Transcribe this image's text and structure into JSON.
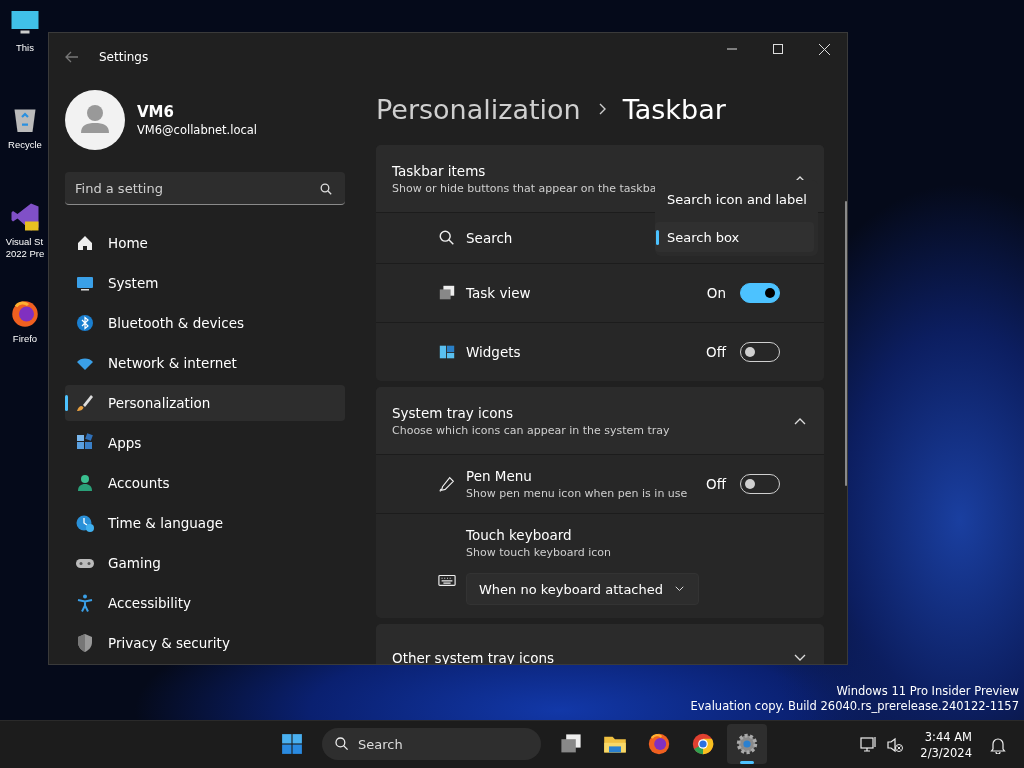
{
  "desktop_icons": [
    {
      "kind": "monitor",
      "lines": [
        "This"
      ]
    },
    {
      "kind": "recycle",
      "lines": [
        "Recycle"
      ]
    },
    {
      "kind": "vs",
      "lines": [
        "Visual St",
        "2022 Pre"
      ]
    },
    {
      "kind": "firefox",
      "lines": [
        "Firefo"
      ]
    }
  ],
  "window": {
    "title": "Settings"
  },
  "user": {
    "name": "VM6",
    "email": "VM6@collabnet.local"
  },
  "search": {
    "placeholder": "Find a setting"
  },
  "nav": [
    {
      "kind": "home",
      "label": "Home",
      "selected": false
    },
    {
      "kind": "system",
      "label": "System",
      "selected": false
    },
    {
      "kind": "bluetooth",
      "label": "Bluetooth & devices",
      "selected": false
    },
    {
      "kind": "network",
      "label": "Network & internet",
      "selected": false
    },
    {
      "kind": "personalization",
      "label": "Personalization",
      "selected": true
    },
    {
      "kind": "apps",
      "label": "Apps",
      "selected": false
    },
    {
      "kind": "accounts",
      "label": "Accounts",
      "selected": false
    },
    {
      "kind": "time",
      "label": "Time & language",
      "selected": false
    },
    {
      "kind": "gaming",
      "label": "Gaming",
      "selected": false
    },
    {
      "kind": "accessibility",
      "label": "Accessibility",
      "selected": false
    },
    {
      "kind": "privacy",
      "label": "Privacy & security",
      "selected": false
    }
  ],
  "breadcrumb": [
    "Personalization",
    "Taskbar"
  ],
  "sections": [
    {
      "title": "Taskbar items",
      "subtitle": "Show or hide buttons that appear on the taskba",
      "expanded": true,
      "items": [
        {
          "kind": "search",
          "label": "Search",
          "options": [
            {
              "label": "Search icon and label",
              "selected": false
            },
            {
              "label": "Search box",
              "selected": true
            }
          ]
        },
        {
          "kind": "taskview",
          "label": "Task view",
          "state": "On",
          "on": true
        },
        {
          "kind": "widgets",
          "label": "Widgets",
          "state": "Off",
          "on": false
        }
      ]
    },
    {
      "title": "System tray icons",
      "subtitle": "Choose which icons can appear in the system tray",
      "expanded": true,
      "items": [
        {
          "kind": "pen",
          "label": "Pen Menu",
          "description": "Show pen menu icon when pen is in use",
          "state": "Off",
          "on": false
        },
        {
          "kind": "keyboard",
          "label": "Touch keyboard",
          "description": "Show touch keyboard icon",
          "value": "When no keyboard attached"
        }
      ]
    },
    {
      "title": "Other system tray icons",
      "expanded": false
    }
  ],
  "desktop_notice": [
    "Windows 11 Pro Insider Preview",
    "Evaluation copy. Build 26040.rs_prerelease.240122-1157"
  ],
  "taskbar": {
    "search_placeholder": "Search",
    "apps": [
      {
        "kind": "taskview",
        "active": false
      },
      {
        "kind": "explorer",
        "active": false
      },
      {
        "kind": "firefox",
        "active": false
      },
      {
        "kind": "chrome",
        "active": false
      },
      {
        "kind": "settings",
        "active": true
      }
    ],
    "time": "3:44 AM",
    "date": "2/3/2024"
  }
}
